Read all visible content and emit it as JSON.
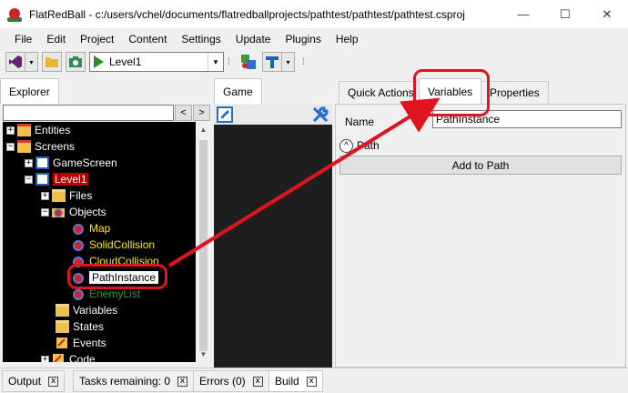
{
  "window": {
    "title": "FlatRedBall - c:/users/vchel/documents/flatredballprojects/pathtest/pathtest/pathtest.csproj",
    "minimize": "—",
    "maximize": "☐",
    "close": "✕"
  },
  "menu": [
    "File",
    "Edit",
    "Project",
    "Content",
    "Settings",
    "Update",
    "Plugins",
    "Help"
  ],
  "toolbar": {
    "screen_combo_value": "Level1",
    "dropdown_glyph": "▾"
  },
  "explorer": {
    "tab_label": "Explorer",
    "search_placeholder": "",
    "back_button": "<",
    "forward_button": ">",
    "tree": [
      {
        "label": "Entities",
        "expander": "+",
        "icon": "folder-icon"
      },
      {
        "label": "Screens",
        "expander": "−",
        "icon": "folder-icon"
      },
      {
        "label": "GameScreen",
        "expander": "+",
        "icon": "screen-icon"
      },
      {
        "label": "Level1",
        "expander": "−",
        "icon": "screen-icon",
        "selected": true
      },
      {
        "label": "Files",
        "expander": "+",
        "icon": "folder-icon"
      },
      {
        "label": "Objects",
        "expander": "−",
        "icon": "objects-icon"
      },
      {
        "label": "Map",
        "icon": "object-icon",
        "color": "yellow"
      },
      {
        "label": "SolidCollision",
        "icon": "object-icon",
        "color": "yellow"
      },
      {
        "label": "CloudCollision",
        "icon": "object-icon",
        "color": "yellow"
      },
      {
        "label": "PathInstance",
        "icon": "object-icon",
        "color": "highlight"
      },
      {
        "label": "EnemyList",
        "icon": "object-icon",
        "color": "green"
      },
      {
        "label": "Variables",
        "icon": "folder-icon"
      },
      {
        "label": "States",
        "icon": "folder-icon"
      },
      {
        "label": "Events",
        "icon": "events-icon"
      },
      {
        "label": "Code",
        "expander": "+",
        "icon": "code-icon"
      }
    ]
  },
  "game": {
    "tab_label": "Game"
  },
  "properties": {
    "tabs": [
      "Quick Actions",
      "Variables",
      "Properties"
    ],
    "active_tab": "Variables",
    "name_label": "Name",
    "name_value": "PathInstance",
    "section_label": "Path",
    "collapse_glyph": "^",
    "add_button_label": "Add to Path"
  },
  "bottom_tabs": [
    {
      "label": "Output",
      "close": "x"
    },
    {
      "label": "Tasks remaining: 0",
      "close": "x"
    },
    {
      "label": "Errors (0)",
      "close": "x"
    },
    {
      "label": "Build",
      "close": "x",
      "active": true
    }
  ],
  "colors": {
    "annotation": "#e0141e",
    "tree_background": "#000000",
    "object_label": "#ffea00",
    "list_label": "#2e9b2e",
    "selected_screen": "#b80000"
  }
}
